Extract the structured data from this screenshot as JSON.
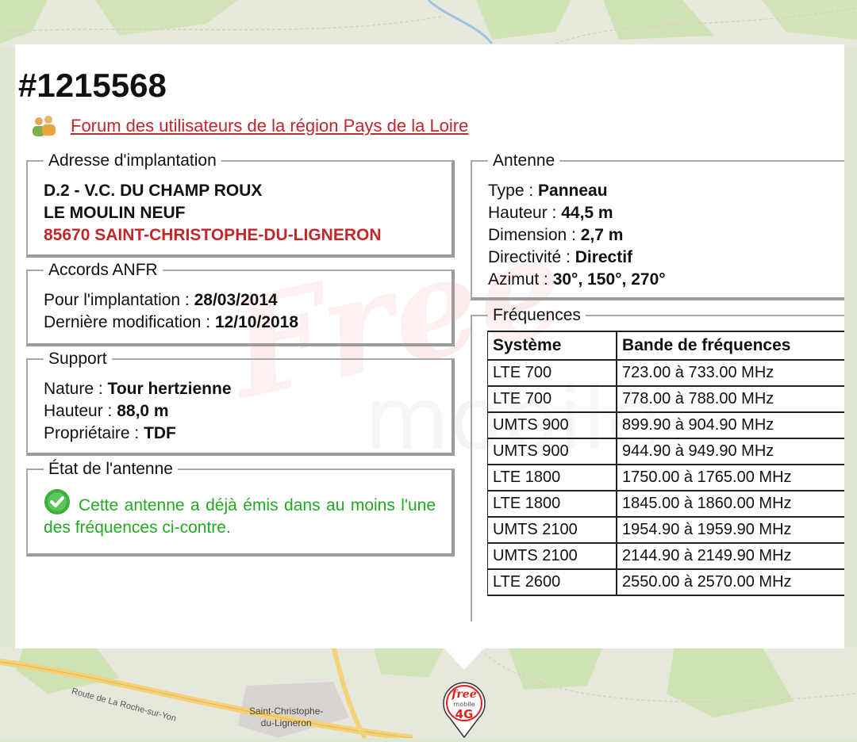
{
  "site": {
    "id": "#1215568",
    "forum_link": "Forum des utilisateurs de la région Pays de la Loire"
  },
  "address": {
    "legend": "Adresse d'implantation",
    "line1": "D.2 - V.C. DU CHAMP ROUX",
    "line2": "LE MOULIN NEUF",
    "line3": "85670 SAINT-CHRISTOPHE-DU-LIGNERON"
  },
  "anfr": {
    "legend": "Accords ANFR",
    "implant_label": "Pour l'implantation : ",
    "implant_value": "28/03/2014",
    "modif_label": "Dernière modification : ",
    "modif_value": "12/10/2018"
  },
  "support": {
    "legend": "Support",
    "nature_label": "Nature : ",
    "nature_value": "Tour hertzienne",
    "height_label": "Hauteur : ",
    "height_value": "88,0 m",
    "owner_label": "Propriétaire : ",
    "owner_value": "TDF"
  },
  "state": {
    "legend": "État de l'antenne",
    "message": "Cette antenne a déjà émis dans au moins l'une des fréquences ci-contre."
  },
  "antenna": {
    "legend": "Antenne",
    "type_label": "Type : ",
    "type_value": "Panneau",
    "height_label": "Hauteur : ",
    "height_value": "44,5 m",
    "dimension_label": "Dimension : ",
    "dimension_value": "2,7 m",
    "directivity_label": "Directivité : ",
    "directivity_value": "Directif",
    "azimuth_label": "Azimut : ",
    "azimuth_value": "30°, 150°, 270°"
  },
  "frequencies": {
    "legend": "Fréquences",
    "headers": [
      "Système",
      "Bande de fréquences"
    ],
    "rows": [
      {
        "system": "LTE 700",
        "band": "723.00 à 733.00 MHz"
      },
      {
        "system": "LTE 700",
        "band": "778.00 à 788.00 MHz"
      },
      {
        "system": "UMTS 900",
        "band": "899.90 à 904.90 MHz"
      },
      {
        "system": "UMTS 900",
        "band": "944.90 à 949.90 MHz"
      },
      {
        "system": "LTE 1800",
        "band": "1750.00 à 1765.00 MHz"
      },
      {
        "system": "LTE 1800",
        "band": "1845.00 à 1860.00 MHz"
      },
      {
        "system": "UMTS 2100",
        "band": "1954.90 à 1959.90 MHz"
      },
      {
        "system": "UMTS 2100",
        "band": "2144.90 à 2149.90 MHz"
      },
      {
        "system": "LTE 2600",
        "band": "2550.00 à 2570.00 MHz"
      }
    ]
  },
  "map": {
    "road_label": "Route de La Roche-sur-Yon",
    "town_line1": "Saint-Christophe-",
    "town_line2": "du-Ligneron",
    "marker_brand": "free",
    "marker_sub": "mobile",
    "marker_tech": "4G"
  },
  "watermark": {
    "brand": "Free",
    "sub": "mobile"
  },
  "colors": {
    "link_red": "#c0282c",
    "status_green": "#22aa22",
    "map_road": "#f3d27a"
  }
}
